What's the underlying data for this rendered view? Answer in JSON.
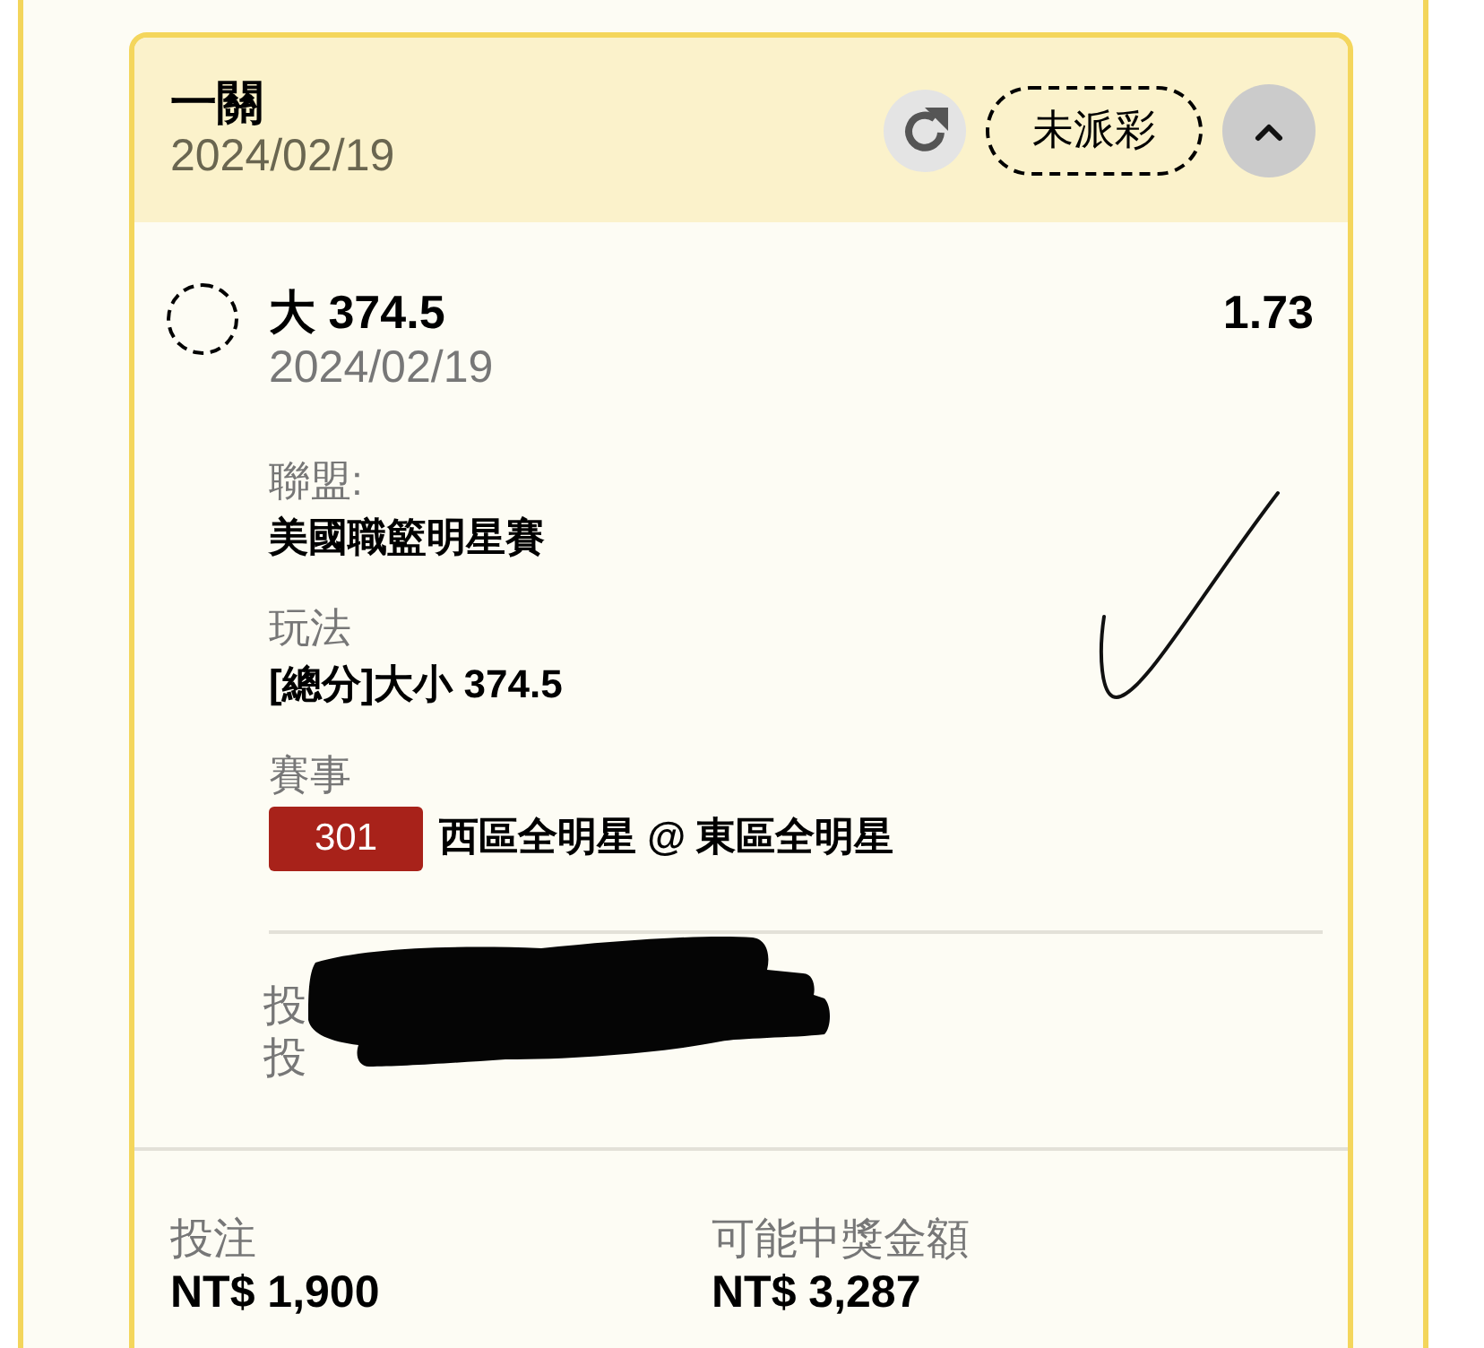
{
  "bet": {
    "title": "一關",
    "date": "2024/02/19",
    "status": "未派彩",
    "expanded": true
  },
  "selections": [
    {
      "name": "大 374.5",
      "odds": "1.73",
      "date": "2024/02/19",
      "settled": false,
      "details": [
        {
          "label": "聯盟:",
          "value": "美國職籃明星賽"
        },
        {
          "label": "玩法",
          "value": "[總分]大小 374.5"
        },
        {
          "label": "賽事",
          "code": "301",
          "value": "西區全明星 @ 東區全明星"
        }
      ]
    }
  ],
  "redacted_lines": [
    "投",
    "投"
  ],
  "totals": [
    {
      "label": "投注",
      "value": "NT$ 1,900"
    },
    {
      "label": "可能中獎金額",
      "value": "NT$ 3,287"
    }
  ]
}
